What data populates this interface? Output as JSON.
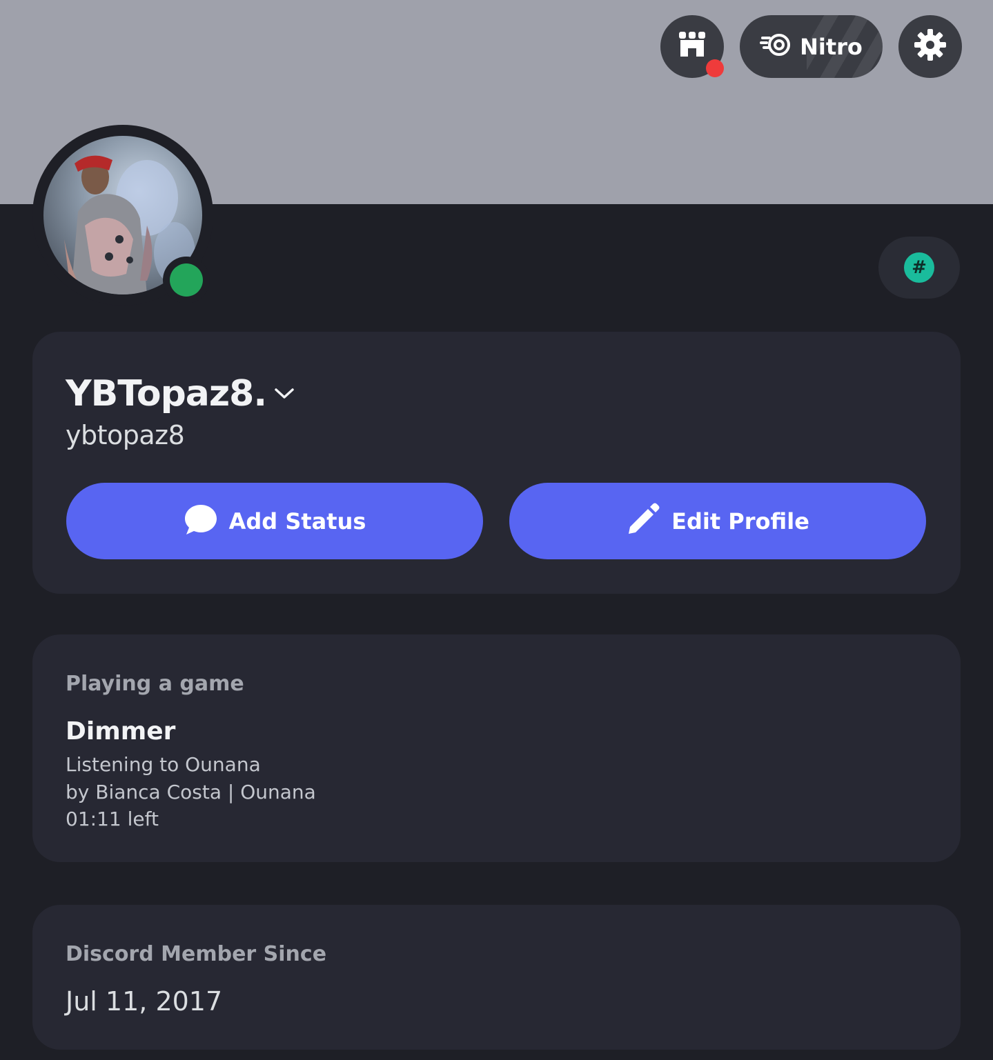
{
  "top_bar": {
    "shop_icon": "shop-icon",
    "nitro_label": "Nitro",
    "nitro_icon": "nitro-icon",
    "settings_icon": "gear-icon"
  },
  "profile": {
    "display_name": "YBTopaz8.",
    "username": "ybtopaz8",
    "status": "online",
    "status_color": "#23a55a"
  },
  "buttons": {
    "add_status": "Add Status",
    "edit_profile": "Edit Profile"
  },
  "activity": {
    "heading": "Playing a game",
    "title": "Dimmer",
    "line1": "Listening to Ounana",
    "line2": "by Bianca Costa | Ounana",
    "line3": "01:11 left"
  },
  "member_since": {
    "heading": "Discord Member Since",
    "date": "Jul 11, 2017"
  },
  "colors": {
    "accent": "#5865f2",
    "banner": "#9fa1ab",
    "background": "#1e1f26",
    "card": "#272833",
    "notification": "#ef3b3b",
    "hash_badge": "#1abc9c"
  }
}
